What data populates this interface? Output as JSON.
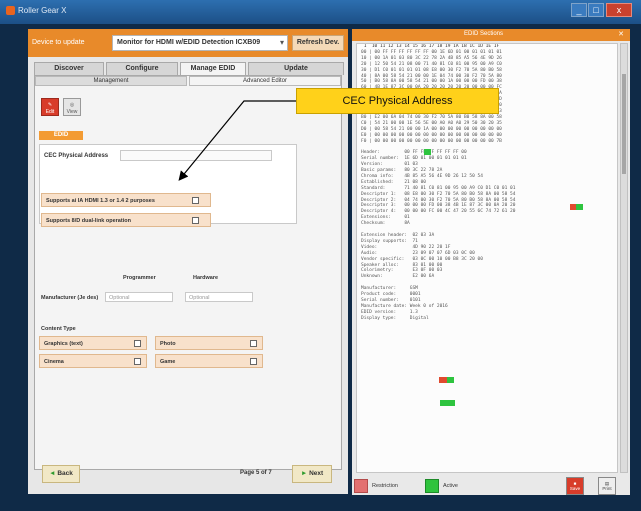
{
  "window": {
    "title": "Roller Gear X",
    "controls": [
      "_",
      "□",
      "x"
    ]
  },
  "left": {
    "device_label": "Device to update",
    "device_value": "Monitor for HDMI w/EDID Detection ICXB09",
    "refresh_label": "Refresh Dev.",
    "tabs": [
      "Discover",
      "Configure",
      "Manage EDID",
      "Update"
    ],
    "subtabs": [
      "Management",
      "Advanced Editor"
    ],
    "edit_label": "Edit",
    "view_label": "View",
    "edid_tag": "EDID",
    "cec_label": "CEC Physical Address",
    "options": [
      "Supports ai IA HDMI 1.3 or 1.4 2 purposes",
      "Supports 8/D dual-link operation"
    ],
    "col_headers": [
      "Programmer",
      "Hardware"
    ],
    "mfg_label": "Manufacturer (Je des)",
    "placeholders": [
      "Optional",
      "Optional"
    ],
    "content_type_label": "Content Type",
    "content_types": [
      "Graphics (text)",
      "Photo",
      "Cinema",
      "Game"
    ],
    "back_label": "Back",
    "next_label": "Next",
    "page_text": "Page 5 of 7"
  },
  "right": {
    "header": "EDID Sections",
    "hex_lines": [
      " 1  10 11 12 13 14 15 16 17 18 19 1A 1B 1C 1D 1E 1F",
      "00 | 00 FF FF FF FF FF FF 00 1E 6D 01 00 01 01 01 01",
      "10 | 00 1A 01 03 80 3C 22 78 2A 4B 85 A5 56 4E 9D 26",
      "20 | 12 50 54 21 08 00 71 40 81 C0 81 00 95 00 A9 C0",
      "30 | D1 C0 01 01 01 01 08 E8 00 30 F2 70 5A 80 B0 58",
      "40 | 8A 00 58 54 21 00 00 1E 04 74 00 30 F2 70 5A 80",
      "50 | B0 58 8A 00 58 54 21 00 00 1A 00 00 00 FD 00 38",
      "60 | 4B 1E 87 3C 00 0A 20 20 20 20 20 20 00 00 00 FC",
      "70 | 00 4C 47 20 55 6C 74 72 61 20 48 44 0A 20 01 8A",
      "80 | 02 03 3A 71 4D 90 22 20 1F 12 03 04 01 61 60 5D",
      "90 | 5E 5F 23 09 07 07 6D 03 0C 00 10 00 B8 3C 20 00",
      "A0 | 60 01 02 03 67 D8 5D C4 01 78 80 03 E3 0F 00 03",
      "B0 | E2 00 6A 04 74 00 30 F2 70 5A 80 B0 58 8A 00 58",
      "C0 | 54 21 00 00 1E 56 5E 00 A0 A0 A0 29 50 30 20 35",
      "D0 | 00 58 54 21 00 00 1A 00 00 00 00 00 00 00 00 00",
      "E0 | 00 00 00 00 00 00 00 00 00 00 00 00 00 00 00 00",
      "F0 | 00 00 00 00 00 00 00 00 00 00 00 00 00 00 00 7B",
      "",
      "Header:         00 FF FF FF FF FF FF 00",
      "Serial number:  1E 6D 01 00 01 01 01 01",
      "Version:        01 03",
      "Basic params:   80 3C 22 78 2A",
      "Chroma info:    4B 85 A5 56 4E 9D 26 12 50 54",
      "Established:    21 08 00",
      "Standard:       71 40 81 C0 81 00 95 00 A9 C0 D1 C0 01 01",
      "Descriptor 1:   08 E8 00 30 F2 70 5A 80 B0 58 8A 00 58 54",
      "Descriptor 2:   04 74 00 30 F2 70 5A 80 B0 58 8A 00 58 54",
      "Descriptor 3:   00 00 00 FD 00 38 4B 1E 87 3C 00 0A 20 20",
      "Descriptor 4:   00 00 00 FC 00 4C 47 20 55 6C 74 72 61 20",
      "Extensions:     01",
      "Checksum:       8A",
      "",
      "Extension header:  02 03 3A",
      "Display supports:  71",
      "Video:             4D 90 22 20 1F",
      "Audio:             23 09 07 07 6D 03 0C 00",
      "Vendor specific:   03 0C 00 10 00 B8 3C 20 00",
      "Speaker alloc:     83 01 00 00",
      "Colorimetry:       E3 0F 00 03",
      "Unknown:           E2 00 6A",
      "",
      "Manufacturer:     GSM",
      "Product code:     0001",
      "Serial number:    0101",
      "Manufacture date: Week 0 of 2016",
      "EDID version:     1.3",
      "Display type:     Digital"
    ],
    "legend_red": "Restriction",
    "legend_green": "Active",
    "btn_a": "Save",
    "btn_b": "Print"
  },
  "callout": {
    "text": "CEC Physical Address"
  }
}
